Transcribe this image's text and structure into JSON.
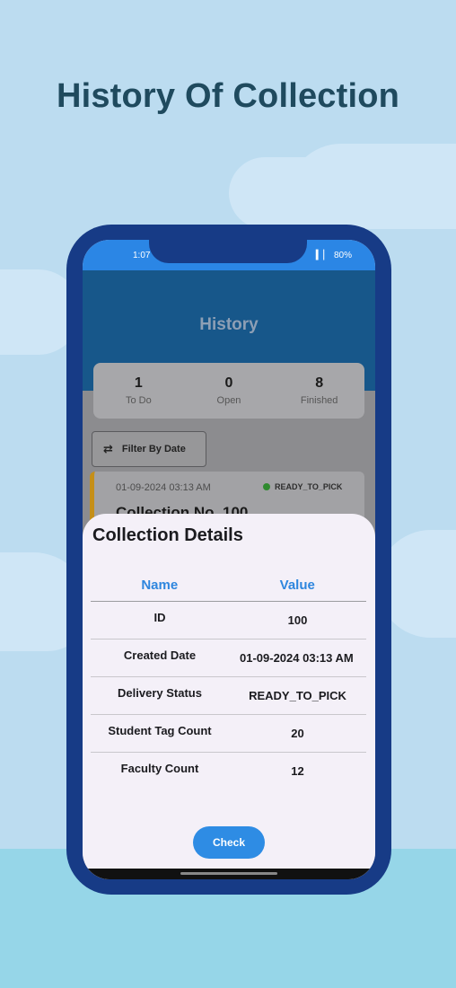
{
  "headline": "History Of Collection",
  "status_bar": {
    "time": "1:07",
    "signal": "▕▎▏",
    "battery": "80%"
  },
  "app": {
    "title": "History"
  },
  "stats": [
    {
      "value": "1",
      "label": "To Do"
    },
    {
      "value": "0",
      "label": "Open"
    },
    {
      "value": "8",
      "label": "Finished"
    }
  ],
  "filter": {
    "label": "Filter By Date",
    "icon": "swap-arrows-icon"
  },
  "collection_item": {
    "date": "01-09-2024 03:13 AM",
    "status": "READY_TO_PICK",
    "title": "Collection No. 100"
  },
  "sheet": {
    "title": "Collection Details",
    "col_name": "Name",
    "col_value": "Value",
    "rows": [
      {
        "name": "ID",
        "value": "100"
      },
      {
        "name": "Created Date",
        "value": "01-09-2024 03:13 AM"
      },
      {
        "name": "Delivery Status",
        "value": "READY_TO_PICK"
      },
      {
        "name": "Student Tag Count",
        "value": "20"
      },
      {
        "name": "Faculty Count",
        "value": "12"
      }
    ],
    "check_label": "Check"
  },
  "colors": {
    "accent": "#2e86de",
    "header": "#17578a",
    "phone_frame": "#173b86",
    "status_green": "#2f8a2f",
    "card_stripe": "#c58f18"
  }
}
